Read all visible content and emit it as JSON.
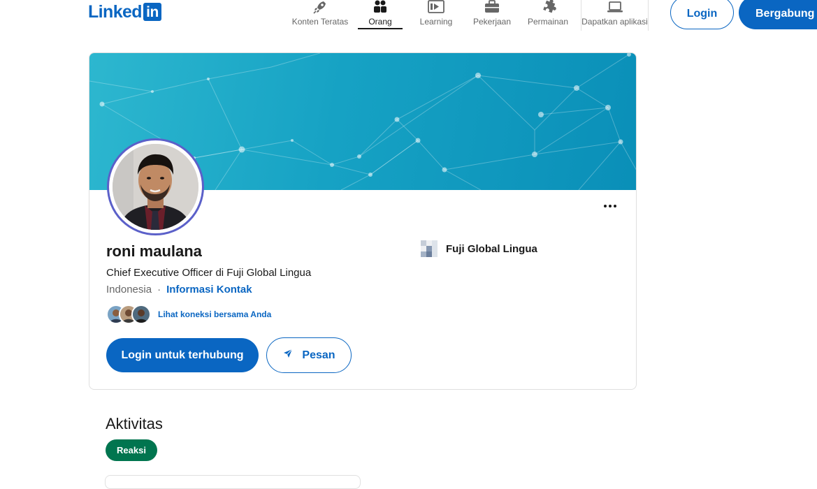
{
  "nav": {
    "logo_text": "Linked",
    "logo_box": "in",
    "items": [
      {
        "label": "Konten Teratas",
        "icon": "rocket-icon"
      },
      {
        "label": "Orang",
        "icon": "people-icon",
        "active": true
      },
      {
        "label": "Learning",
        "icon": "video-icon"
      },
      {
        "label": "Pekerjaan",
        "icon": "briefcase-icon"
      },
      {
        "label": "Permainan",
        "icon": "puzzle-icon"
      },
      {
        "label": "Dapatkan aplikasi",
        "icon": "laptop-icon"
      }
    ],
    "login_label": "Login",
    "join_label": "Bergabung sekarang"
  },
  "profile": {
    "name": "roni maulana",
    "headline": "Chief Executive Officer di Fuji Global Lingua",
    "location": "Indonesia",
    "separator": "·",
    "contact_link": "Informasi Kontak",
    "mutual_connections": "Lihat koneksi bersama Anda",
    "connect_button": "Login untuk terhubung",
    "message_button": "Pesan",
    "company": "Fuji Global Lingua"
  },
  "activity": {
    "title": "Aktivitas",
    "chip": "Reaksi"
  },
  "colors": {
    "brand": "#0a66c2",
    "chip": "#01754f",
    "avatar_ring": "#5b60c9"
  }
}
